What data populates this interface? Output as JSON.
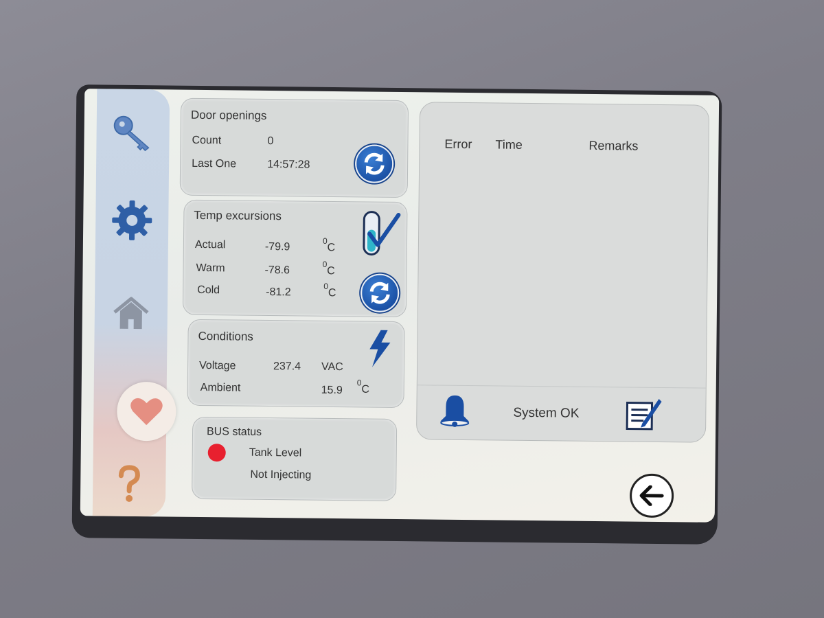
{
  "door_openings": {
    "title": "Door openings",
    "count_label": "Count",
    "count_value": "0",
    "last_label": "Last One",
    "last_value": "14:57:28"
  },
  "temp_excursions": {
    "title": "Temp excursions",
    "rows": [
      {
        "label": "Actual",
        "value": "-79.9",
        "unit_sup": "0",
        "unit": "C"
      },
      {
        "label": "Warm",
        "value": "-78.6",
        "unit_sup": "0",
        "unit": "C"
      },
      {
        "label": "Cold",
        "value": "-81.2",
        "unit_sup": "0",
        "unit": "C"
      }
    ]
  },
  "conditions": {
    "title": "Conditions",
    "voltage_label": "Voltage",
    "voltage_value": "237.4",
    "voltage_unit": "VAC",
    "ambient_label": "Ambient",
    "ambient_value": "15.9",
    "ambient_unit_sup": "0",
    "ambient_unit": "C"
  },
  "bus_status": {
    "title": "BUS status",
    "line1": "Tank Level",
    "line2": "Not Injecting",
    "indicator_color": "#e8202f"
  },
  "error_log": {
    "headers": {
      "error": "Error",
      "time": "Time",
      "remarks": "Remarks"
    },
    "status_text": "System OK"
  },
  "sidebar": {
    "items": [
      "key-icon",
      "gear-icon",
      "home-icon",
      "heart-icon",
      "help-icon"
    ]
  },
  "colors": {
    "accent_blue": "#1a4ea3",
    "alarm_red": "#e8202f"
  }
}
